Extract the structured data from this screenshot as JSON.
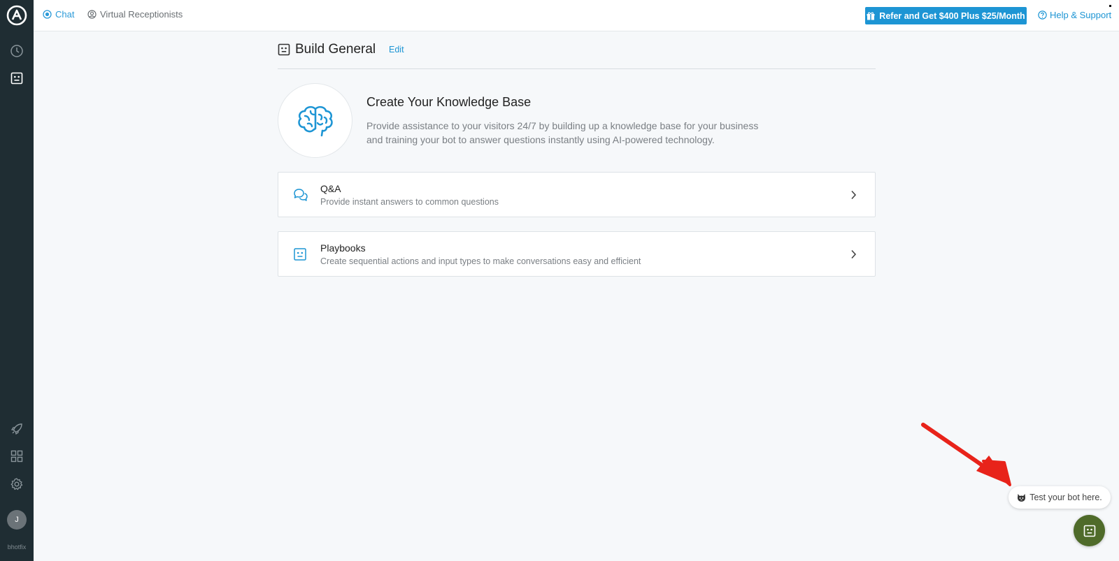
{
  "colors": {
    "sidebar_bg": "#1f2d33",
    "accent": "#1d95d4",
    "bot_button": "#4f6b2a",
    "annotation_arrow": "#e8231a"
  },
  "sidebar": {
    "items": [
      {
        "icon": "clock-icon"
      },
      {
        "icon": "bot-icon"
      },
      {
        "icon": "rocket-icon"
      },
      {
        "icon": "apps-grid-icon"
      },
      {
        "icon": "gear-icon"
      }
    ],
    "avatar_initial": "J",
    "username": "bhotfix"
  },
  "topbar": {
    "tabs": [
      {
        "label": "Chat",
        "icon": "chat-bubble-icon"
      },
      {
        "label": "Virtual Receptionists",
        "icon": "receptionist-icon"
      }
    ],
    "refer_label": "Refer and Get $400 Plus $25/Month",
    "help_label": "Help & Support"
  },
  "header": {
    "title": "Build General",
    "edit_label": "Edit"
  },
  "hero": {
    "title": "Create Your Knowledge Base",
    "description_line1": "Provide assistance to your visitors 24/7 by building up a knowledge base for your business",
    "description_line2": "and training your bot to answer questions instantly using AI-powered technology."
  },
  "cards": [
    {
      "title": "Q&A",
      "subtitle": "Provide instant answers to common questions",
      "icon": "chat-bubbles-icon"
    },
    {
      "title": "Playbooks",
      "subtitle": "Create sequential actions and input types to make conversations easy and efficient",
      "icon": "bot-icon"
    }
  ],
  "bot_test": {
    "label": "Test your bot here."
  }
}
